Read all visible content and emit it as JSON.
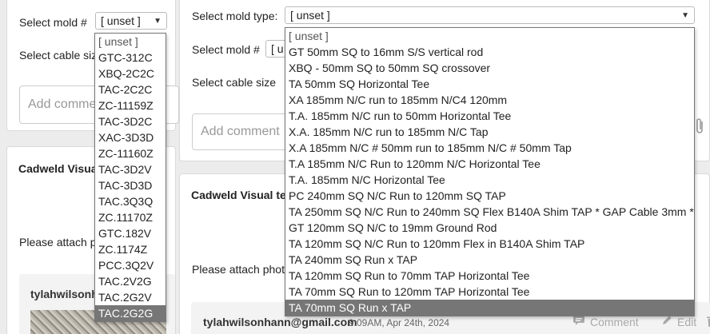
{
  "left_panel": {
    "select_mold_label": "Select mold #",
    "select_mold_value": "[ unset ]",
    "select_cable_label": "Select cable size",
    "add_comment_placeholder": "Add comment",
    "heading": "Cadweld Visual",
    "attach_label": "Please attach p",
    "email": "tylahwilsonhann"
  },
  "left_dropdown": {
    "options": [
      "[ unset ]",
      "GTC-312C",
      "XBQ-2C2C",
      "TAC-2C2C",
      "ZC-11159Z",
      "TAC-3D2C",
      "XAC-3D3D",
      "ZC-11160Z",
      "TAC-3D2V",
      "TAC-3D3D",
      "TAC.3Q3Q",
      "ZC.11170Z",
      "GTC.182V",
      "ZC.1174Z",
      "PCC.3Q2V",
      "TAC.2V2G",
      "TAC.2G2V",
      "TAC.2G2G"
    ],
    "selected_index": 17
  },
  "right_panel": {
    "mold_type_label": "Select mold type:",
    "mold_type_value": "[ unset ]",
    "select_mold_label": "Select mold #",
    "select_mold_value": "[ u",
    "select_cable_label": "Select cable size",
    "add_comment_placeholder": "Add comment",
    "heading": "Cadweld Visual tes",
    "attach_label": "Please attach photo",
    "email": "tylahwilsonhann@gmail.com",
    "timestamp": "9:09AM, Apr 24th, 2024",
    "comment_action": "Comment",
    "edit_action": "Edit"
  },
  "right_dropdown": {
    "options": [
      "[ unset ]",
      "GT 50mm SQ to 16mm S/S vertical rod",
      "XBQ - 50mm SQ to 50mm SQ crossover",
      "TA 50mm SQ Horizontal Tee",
      "XA 185mm N/C run to 185mm N/C4 120mm",
      "T.A. 185mm N/C run to 50mm Horizontal Tee",
      "X.A. 185mm N/C run to 185mm N/C Tap",
      "X.A 185mm N/C # 50mm run to 185mm N/C # 50mm Tap",
      "T.A 185mm N/C Run to 120mm N/C Horizontal Tee",
      "T.A. 185mm N/C Horizontal Tee",
      "PC 240mm SQ N/C Run to 120mm SQ TAP",
      "TA 250mm SQ N/C Run to 240mm SQ Flex B140A Shim TAP * GAP Cable 3mm *",
      "GT 120mm SQ N/C to 19mm Ground Rod",
      "TA 120mm SQ N/C Run to 120mm Flex in B140A Shim TAP",
      "TA 240mm SQ Run x TAP",
      "TA 120mm SQ Run to 70mm TAP Horizontal Tee",
      "TA 70mm SQ Run to 120mm TAP Horizontal Tee",
      "TA 70mm SQ Run x TAP"
    ],
    "selected_index": 17
  },
  "icons": [
    "chevron-down-icon",
    "paperclip-icon",
    "comment-icon",
    "edit-icon",
    "trash-icon"
  ],
  "colors": {
    "selected_option_bg": "#767676",
    "selected_option_fg": "#ffffff"
  }
}
